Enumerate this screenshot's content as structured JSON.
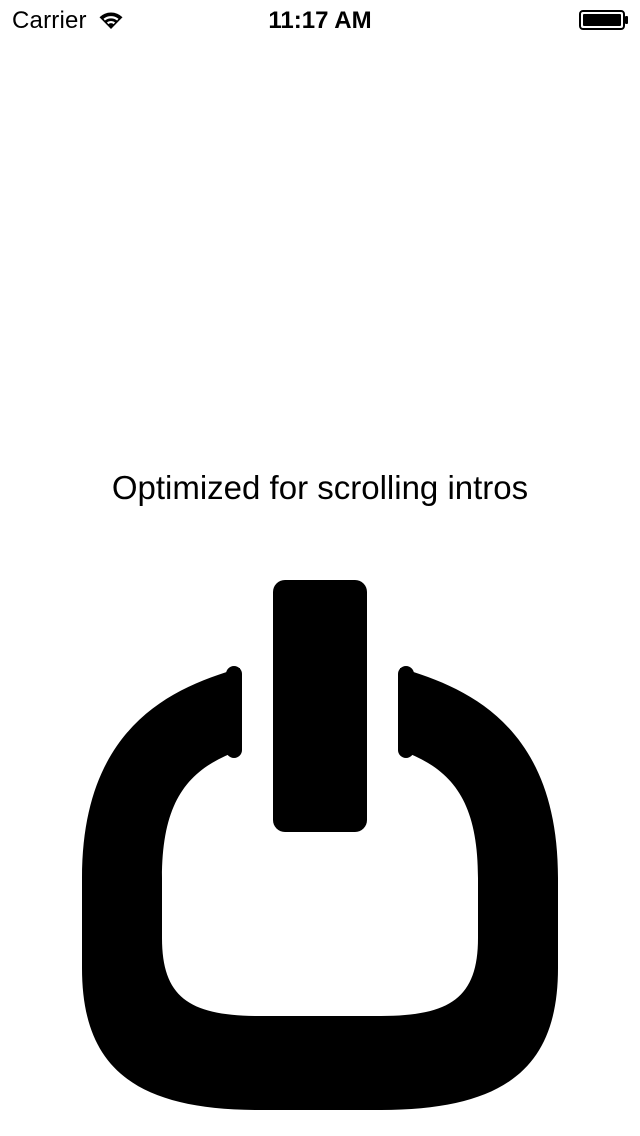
{
  "status_bar": {
    "carrier": "Carrier",
    "time": "11:17 AM",
    "wifi_icon": "wifi-icon",
    "battery_icon": "battery-full-icon"
  },
  "intro": {
    "tagline": "Optimized for scrolling intros",
    "artwork_icon": "power-icon"
  },
  "colors": {
    "background": "#ffffff",
    "foreground": "#000000"
  }
}
